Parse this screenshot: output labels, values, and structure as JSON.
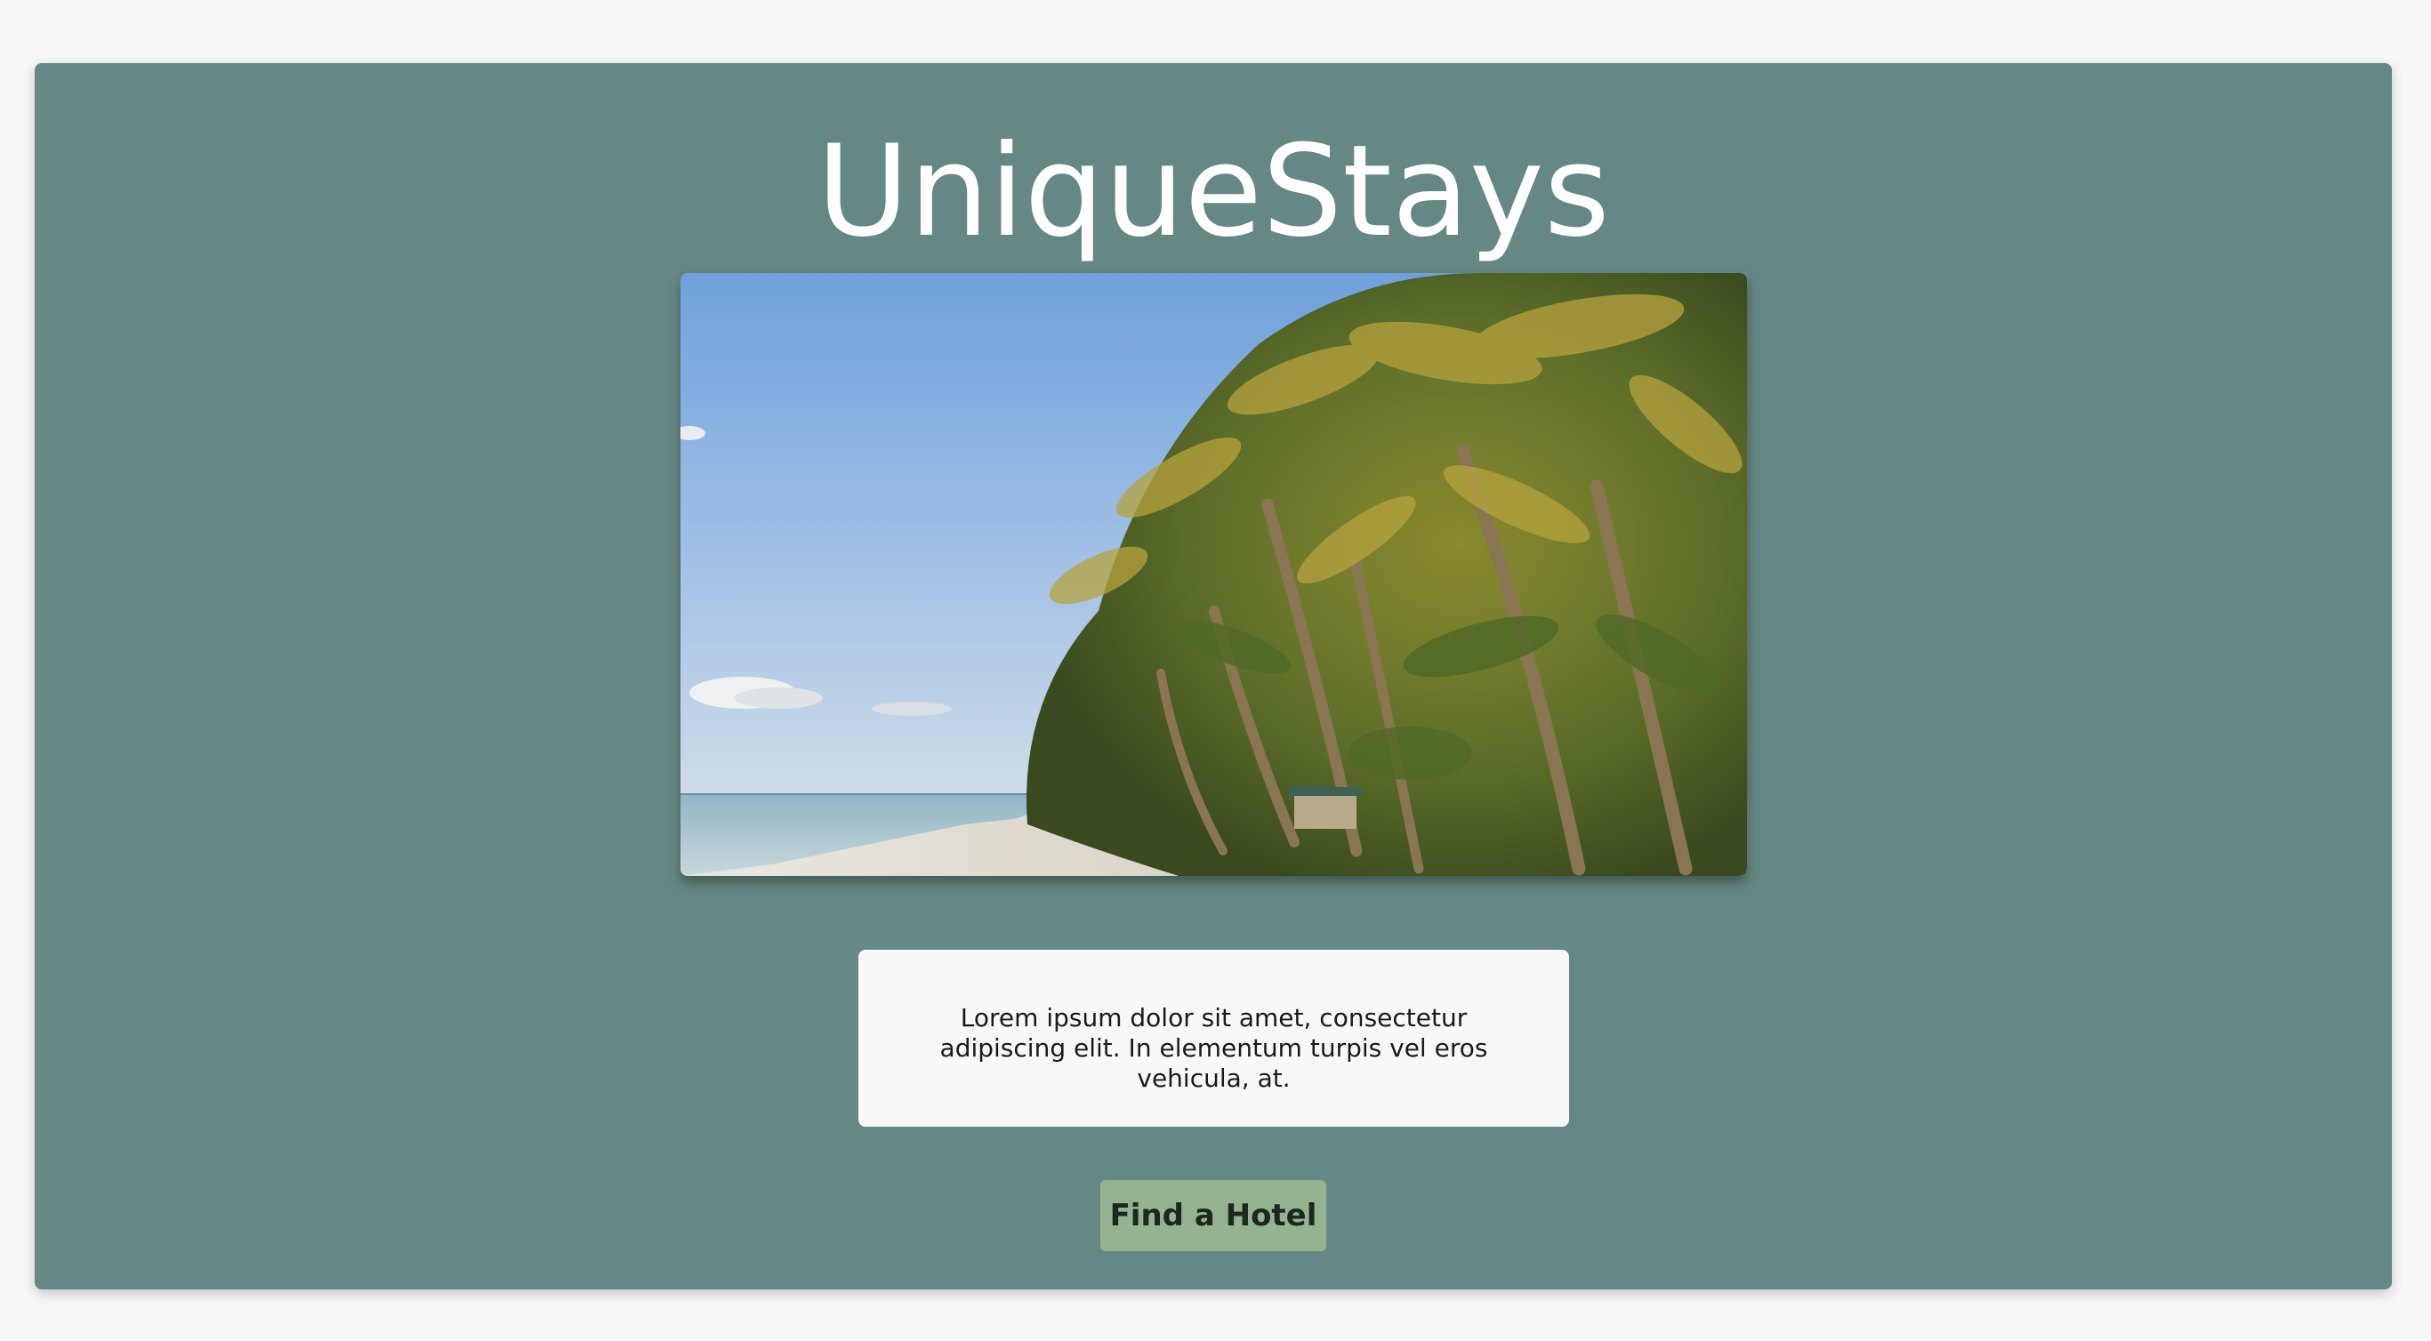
{
  "header": {
    "title": "UniqueStays"
  },
  "hero": {
    "alt": "Tropical beach with leaning palm trees"
  },
  "description": {
    "text": "Lorem ipsum dolor sit amet, consectetur adipiscing elit. In elementum turpis vel eros vehicula, at."
  },
  "cta": {
    "label": "Find a Hotel"
  },
  "colors": {
    "page_background": "#f8f8f8",
    "card_background": "#668884",
    "button_background": "#93b48e",
    "title_text": "#ffffff"
  }
}
